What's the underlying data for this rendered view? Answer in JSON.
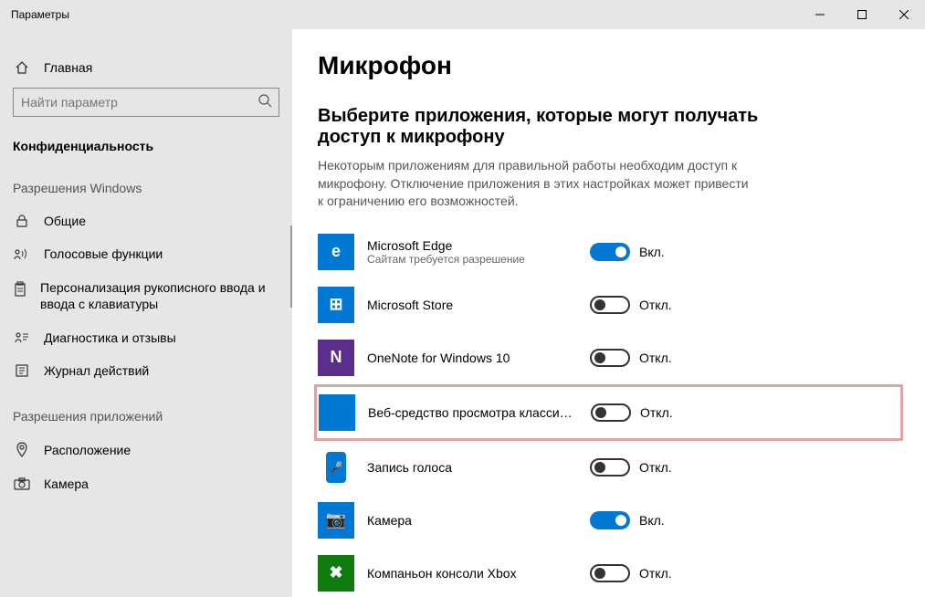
{
  "window": {
    "title": "Параметры"
  },
  "sidebar": {
    "home": "Главная",
    "search_placeholder": "Найти параметр",
    "privacy_label": "Конфиденциальность",
    "group_windows": "Разрешения Windows",
    "group_apps": "Разрешения приложений",
    "items_win": [
      {
        "label": "Общие"
      },
      {
        "label": "Голосовые функции"
      },
      {
        "label": "Персонализация рукописного ввода и ввода с клавиатуры"
      },
      {
        "label": "Диагностика и отзывы"
      },
      {
        "label": "Журнал действий"
      }
    ],
    "items_app": [
      {
        "label": "Расположение"
      },
      {
        "label": "Камера"
      }
    ]
  },
  "main": {
    "title": "Микрофон",
    "subheading": "Выберите приложения, которые могут получать доступ к микрофону",
    "description": "Некоторым приложениям для правильной работы необходим доступ к микрофону. Отключение приложения в этих настройках может привести к ограничению его возможностей.",
    "on_label": "Вкл.",
    "off_label": "Откл.",
    "apps": [
      {
        "name": "Microsoft Edge",
        "sub": "Сайтам требуется разрешение",
        "on": true,
        "color": "#0078d4",
        "glyph": "e"
      },
      {
        "name": "Microsoft Store",
        "sub": "",
        "on": false,
        "color": "#0078d4",
        "glyph": "⊞"
      },
      {
        "name": "OneNote for Windows 10",
        "sub": "",
        "on": false,
        "color": "#5b2d8c",
        "glyph": "N"
      },
      {
        "name": "Веб-средство просмотра классиче...",
        "sub": "",
        "on": false,
        "color": "#0078d4",
        "glyph": "",
        "highlight": true
      },
      {
        "name": "Запись голоса",
        "sub": "",
        "on": false,
        "color": "#0078d4",
        "glyph": "🎤",
        "small": true
      },
      {
        "name": "Камера",
        "sub": "",
        "on": true,
        "color": "#0078d4",
        "glyph": "📷"
      },
      {
        "name": "Компаньон консоли Xbox",
        "sub": "",
        "on": false,
        "color": "#107c10",
        "glyph": "✖"
      }
    ]
  }
}
